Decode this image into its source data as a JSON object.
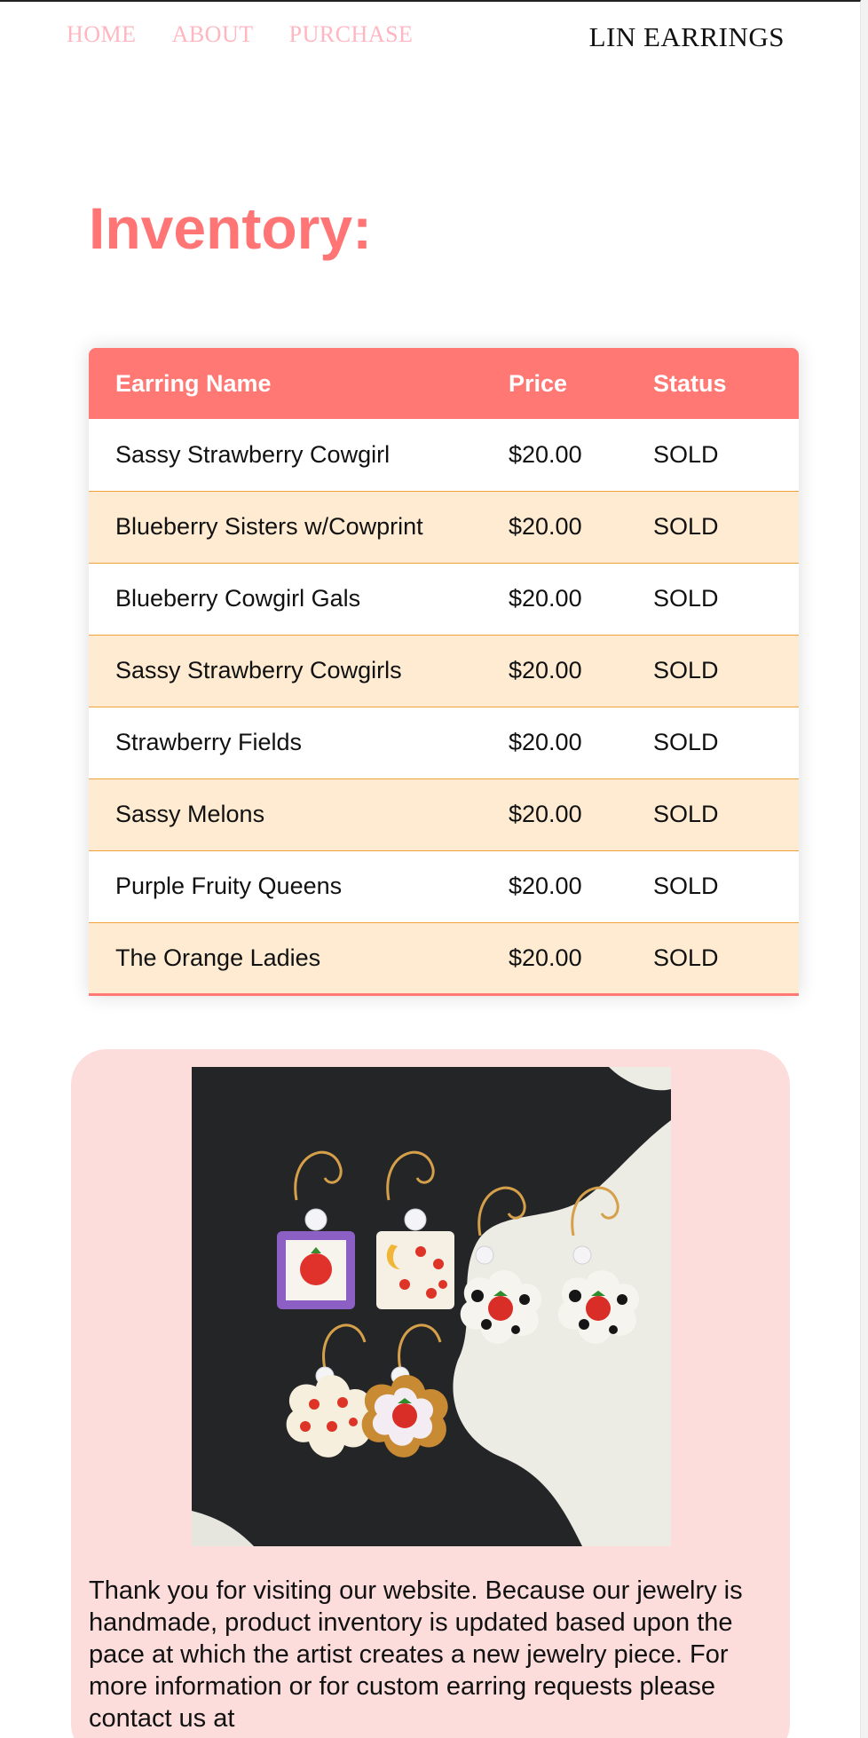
{
  "nav": {
    "items": [
      "HOME",
      "ABOUT",
      "PURCHASE"
    ],
    "brand": "LIN EARRINGS"
  },
  "page": {
    "heading": "Inventory:"
  },
  "table": {
    "headers": [
      "Earring Name",
      "Price",
      "Status"
    ],
    "rows": [
      [
        "Sassy Strawberry Cowgirl",
        "$20.00",
        "SOLD"
      ],
      [
        "Blueberry Sisters w/Cowprint",
        "$20.00",
        "SOLD"
      ],
      [
        "Blueberry Cowgirl Gals",
        "$20.00",
        "SOLD"
      ],
      [
        "Sassy Strawberry Cowgirls",
        "$20.00",
        "SOLD"
      ],
      [
        "Strawberry Fields",
        "$20.00",
        "SOLD"
      ],
      [
        "Sassy Melons",
        "$20.00",
        "SOLD"
      ],
      [
        "Purple Fruity Queens",
        "$20.00",
        "SOLD"
      ],
      [
        "The Orange Ladies",
        "$20.00",
        "SOLD"
      ]
    ]
  },
  "card": {
    "text": "Thank you for visiting our website. Because our jewelry is handmade, product inventory is updated based upon the pace at which the artist creates a new jewelry piece. For more information or for custom earring requests please contact us at"
  },
  "colors": {
    "nav_link": "#ffb6c1",
    "heading": "#ff7474",
    "table_header": "#ff7874",
    "row_alt": "#feebd2",
    "row_border": "#f3a23b",
    "card_bg": "#fddcdc"
  }
}
